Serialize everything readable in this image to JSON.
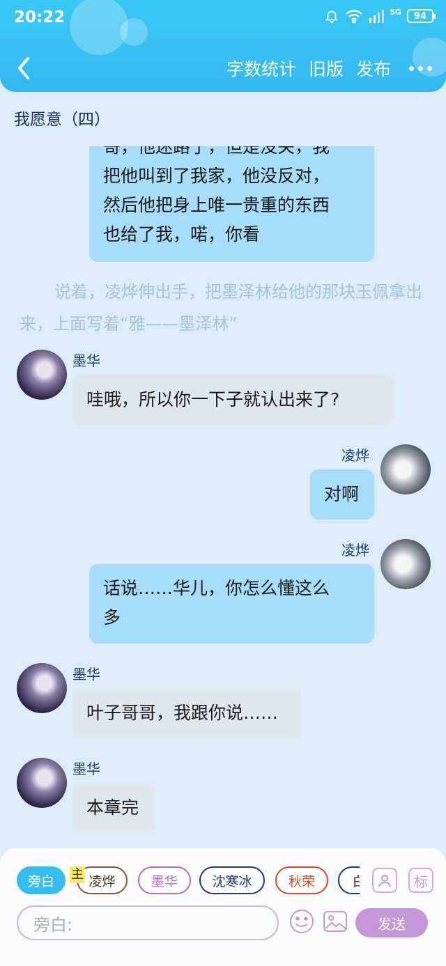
{
  "status_bar": {
    "time": "20:22",
    "network": "5G",
    "battery": "94"
  },
  "header": {
    "word_count_label": "字数统计",
    "old_version_label": "旧版",
    "publish_label": "发布"
  },
  "chapter": {
    "title": "我愿意（四）"
  },
  "messages": [
    {
      "side": "right",
      "lines": [
        "哥，他迷路了，但是没关，我",
        "把他叫到了我家，他没反对，",
        "然后他把身上唯一贵重的东西",
        "也给了我，喏，你看"
      ]
    },
    {
      "type": "narration",
      "text": "说着，凌烨伸出手，把墨泽林给他的那块玉佩拿出来，上面写着“雅——墨泽林”"
    },
    {
      "side": "left",
      "name": "墨华",
      "text": "哇哦，所以你一下子就认出来了?"
    },
    {
      "side": "right",
      "name": "凌烨",
      "text": "对啊"
    },
    {
      "side": "right",
      "name": "凌烨",
      "text": "话说……华儿，你怎么懂这么多"
    },
    {
      "side": "left",
      "name": "墨华",
      "text": "叶子哥哥，我跟你说……"
    },
    {
      "side": "left",
      "name": "墨华",
      "text": "本章完"
    }
  ],
  "composer": {
    "chips": [
      {
        "label": "旁白",
        "color": "#35bdf0",
        "active": true
      },
      {
        "label": "凌烨",
        "color": "#7a5a3a"
      },
      {
        "label": "墨华",
        "color": "#b36cc4"
      },
      {
        "label": "沈寒冰",
        "color": "#1e3a6e"
      },
      {
        "label": "秋荣",
        "color": "#d64a3a"
      },
      {
        "label": "白",
        "color": "#1e3a6e"
      }
    ],
    "main_badge": "主",
    "tag_label": "标",
    "input_placeholder": "旁白:",
    "send_label": "发送"
  },
  "colors": {
    "header": "#38c8f4",
    "right_bubble": "#a7dcfb",
    "left_bubble": "#dfe6ee",
    "send": "#c597d8"
  }
}
